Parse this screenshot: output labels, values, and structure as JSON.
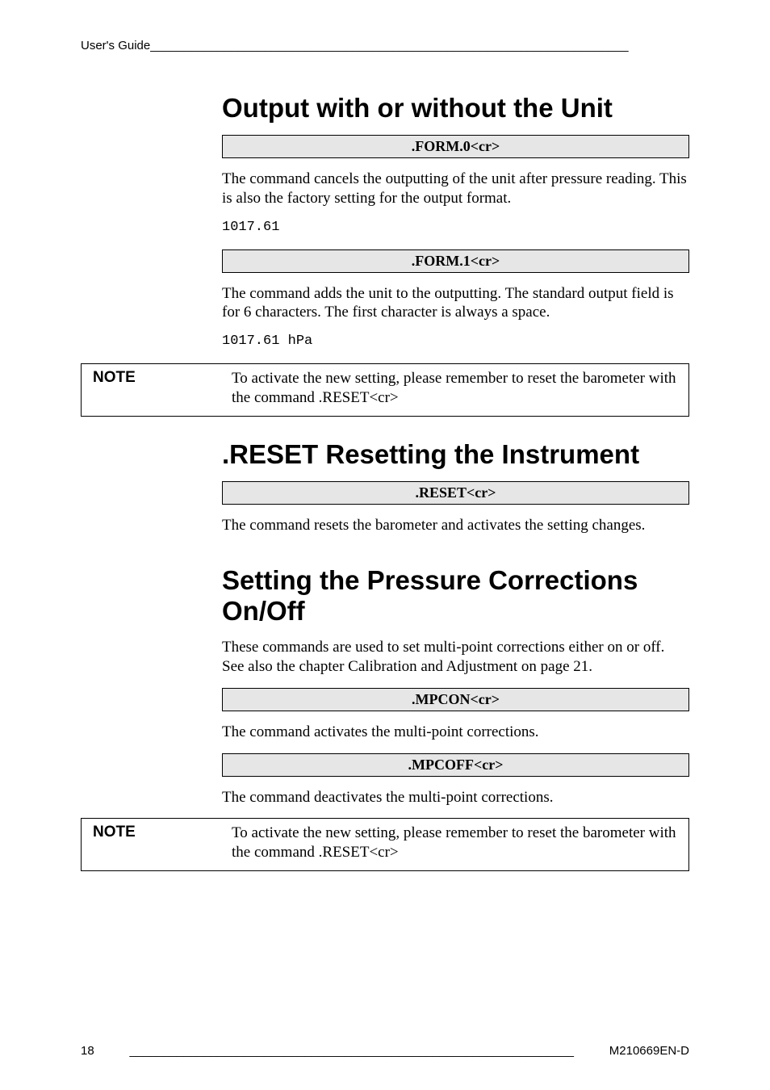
{
  "header": {
    "left": "User's Guide",
    "rule": "_______________________________________________________________________"
  },
  "sections": {
    "output_unit": {
      "title": "Output with or without the Unit",
      "cmd_form0": ".FORM.0<cr>",
      "form0_text": "The command cancels the outputting of the unit after pressure reading. This is also the factory setting for the output format.",
      "form0_sample": "1017.61",
      "cmd_form1": ".FORM.1<cr>",
      "form1_text": "The command adds the unit to the outputting. The standard output field is for 6 characters. The first character is always a space.",
      "form1_sample": "1017.61 hPa"
    },
    "note1": {
      "label": "NOTE",
      "text_pre": "To activate the new setting, please remember to reset the barometer with the command ",
      "cmd": ".RESET",
      "text_post": "<cr>"
    },
    "reset": {
      "title": ".RESET Resetting the Instrument",
      "cmd": ".RESET<cr>",
      "text": "The command resets the barometer and activates the setting changes."
    },
    "pressure": {
      "title": "Setting the Pressure Corrections On/Off",
      "intro": "These commands are used to set multi-point corrections either on or off. See also the chapter Calibration and Adjustment on page 21.",
      "cmd_on": ".MPCON<cr>",
      "on_text": "The command activates the multi-point corrections.",
      "cmd_off": ".MPCOFF<cr>",
      "off_text": "The command deactivates the multi-point corrections."
    },
    "note2": {
      "label": "NOTE",
      "text_pre": "To activate the new setting, please remember to reset the barometer with the command ",
      "cmd": ".RESET",
      "text_post": "<cr>"
    }
  },
  "footer": {
    "page": "18",
    "rule": " __________________________________________________________________ ",
    "docid": "M210669EN-D"
  }
}
